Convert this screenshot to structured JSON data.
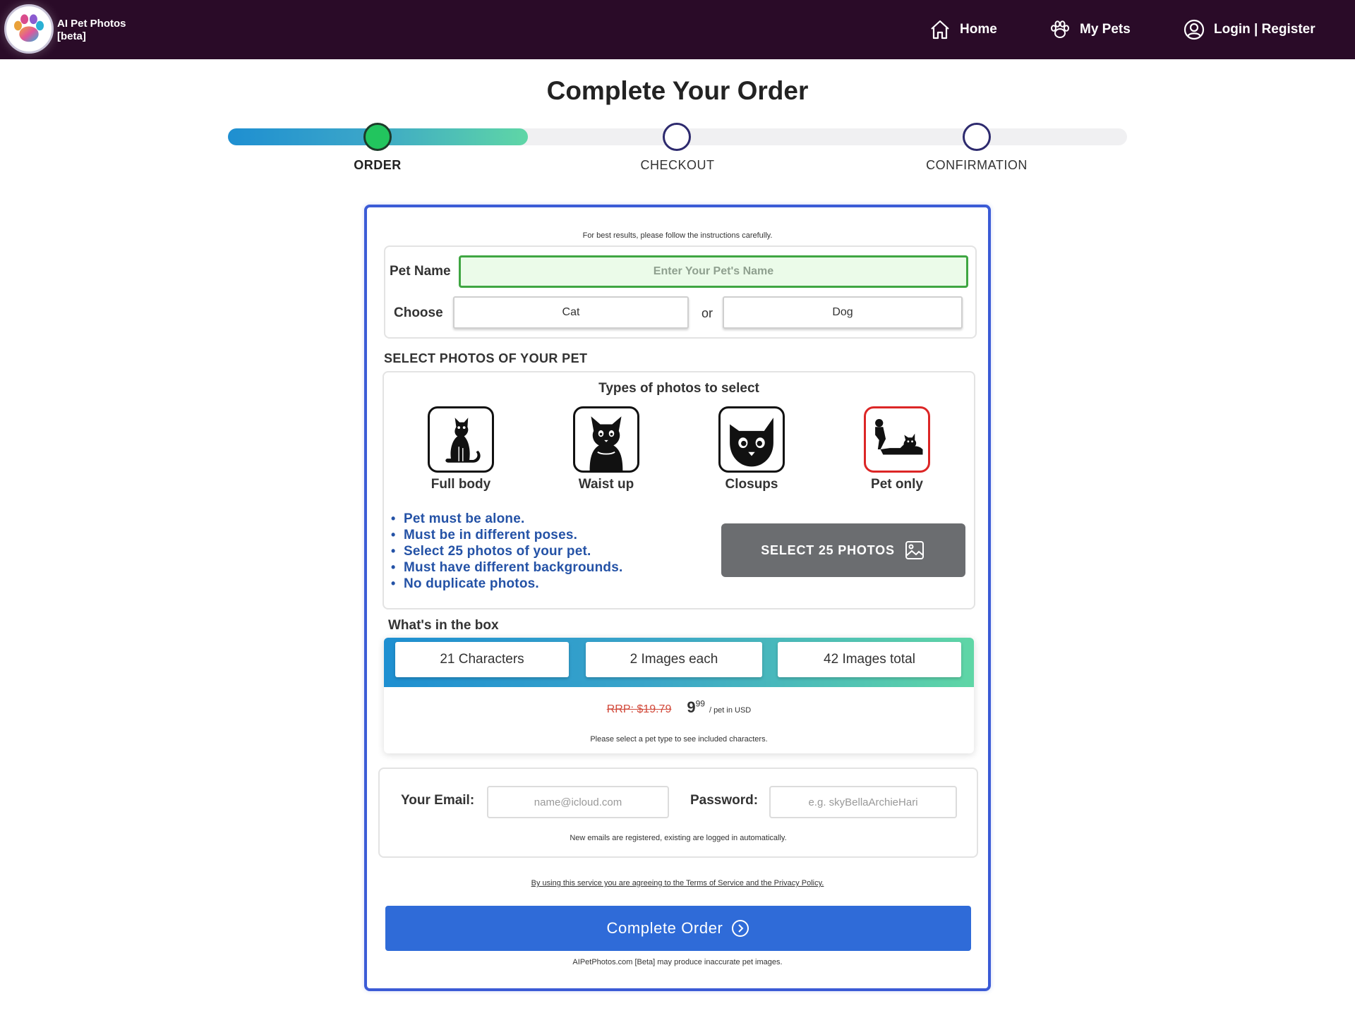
{
  "nav": {
    "brand_line1": "AI Pet Photos",
    "brand_line2": "[beta]",
    "home": "Home",
    "my_pets": "My Pets",
    "login": "Login | Register",
    "bg_color": "#2a0b28"
  },
  "page": {
    "title": "Complete Your Order"
  },
  "stepper": {
    "steps": [
      {
        "label": "ORDER",
        "state": "active"
      },
      {
        "label": "CHECKOUT",
        "state": "pending"
      },
      {
        "label": "CONFIRMATION",
        "state": "pending"
      }
    ],
    "active_color": "#22c55e"
  },
  "form": {
    "hint": "For best results, please follow the instructions carefully.",
    "pet_name_label": "Pet Name",
    "pet_name_placeholder": "Enter Your Pet's Name",
    "choose_label": "Choose",
    "choice_cat": "Cat",
    "or": "or",
    "choice_dog": "Dog"
  },
  "photos": {
    "section_title": "SELECT PHOTOS OF YOUR PET",
    "types_title": "Types of photos to select",
    "types": [
      {
        "label": "Full body",
        "icon": "cat-full-body-icon"
      },
      {
        "label": "Waist up",
        "icon": "cat-waist-up-icon"
      },
      {
        "label": "Closups",
        "icon": "cat-closeup-icon"
      },
      {
        "label": "Pet only",
        "icon": "pet-only-icon"
      }
    ],
    "rules": [
      "Pet must be alone.",
      "Must be in different poses.",
      "Select 25 photos of your pet.",
      "Must have different backgrounds.",
      "No duplicate photos."
    ],
    "select_button": "SELECT 25 PHOTOS"
  },
  "box": {
    "title": "What's in the box",
    "chips": [
      "21 Characters",
      "2 Images each",
      "42 Images total"
    ],
    "rrp": "RRP: $19.79",
    "price_main": "9",
    "price_cents": "99",
    "price_unit": "/ pet in USD",
    "note": "Please select a pet type to see included characters."
  },
  "account": {
    "email_label": "Your Email:",
    "email_placeholder": "name@icloud.com",
    "password_label": "Password:",
    "password_placeholder": "e.g. skyBellaArchieHari",
    "note": "New emails are registered, existing are logged in automatically."
  },
  "footer": {
    "terms": "By using this service you are agreeing to the Terms of Service and the Privacy Policy.",
    "cta": "Complete Order",
    "disclaimer": "AIPetPhotos.com [Beta] may produce inaccurate pet images.",
    "cta_color": "#2f6bd8"
  }
}
